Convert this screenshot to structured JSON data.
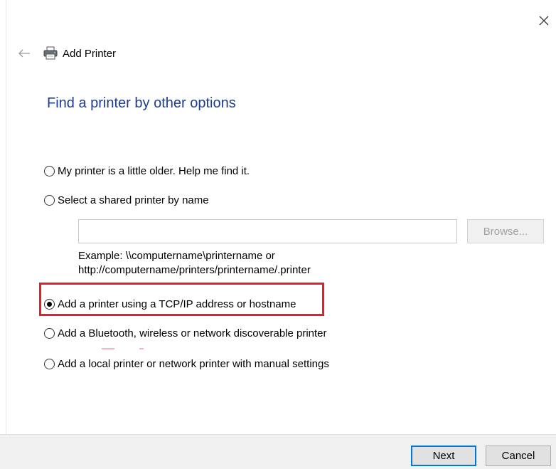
{
  "window": {
    "title": "Add Printer"
  },
  "page": {
    "heading": "Find a printer by other options"
  },
  "options": [
    {
      "label": "My printer is a little older. Help me find it.",
      "selected": false
    },
    {
      "label": "Select a shared printer by name",
      "selected": false
    },
    {
      "label": "Add a printer using a TCP/IP address or hostname",
      "selected": true
    },
    {
      "label": "Add a Bluetooth, wireless or network discoverable printer",
      "selected": false
    },
    {
      "label": "Add a local printer or network printer with manual settings",
      "selected": false
    }
  ],
  "shared_printer": {
    "input_value": "",
    "browse_label": "Browse...",
    "example_line1": "Example: \\\\computername\\printername or",
    "example_line2": "http://computername/printers/printername/.printer"
  },
  "footer": {
    "next_label": "Next",
    "cancel_label": "Cancel"
  },
  "icons": {
    "close": "close-icon",
    "back": "back-arrow-icon",
    "printer": "printer-icon"
  },
  "colors": {
    "heading": "#1e3d8f",
    "highlight": "#e0202e",
    "default_button_border": "#0078d7",
    "footer_bg": "#f0f0f0"
  }
}
